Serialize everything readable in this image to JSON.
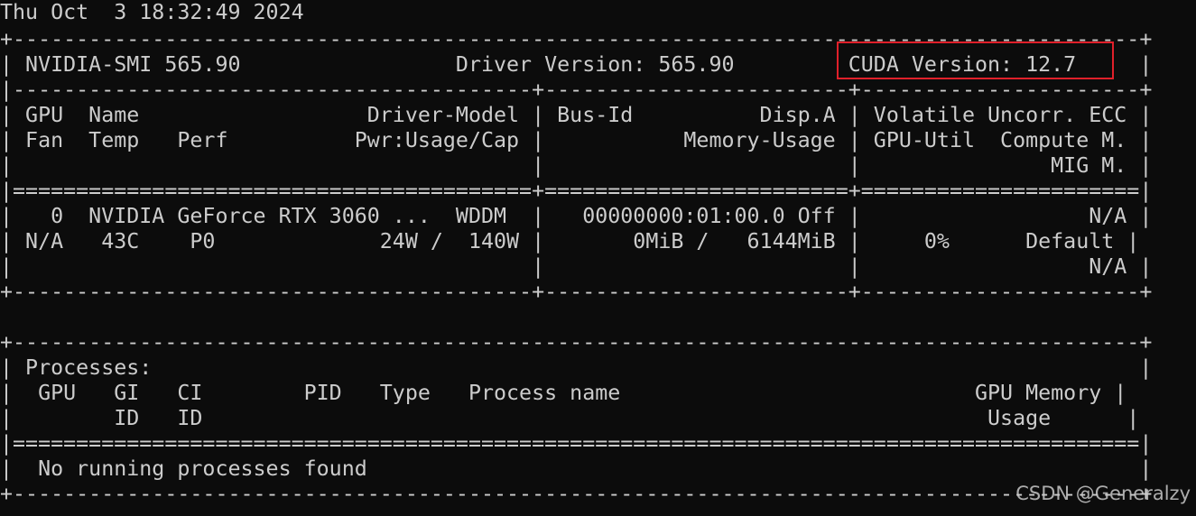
{
  "terminal": {
    "lines": [
      "Thu Oct  3 18:32:49 2024",
      "+-----------------------------------------------------------------------------------------+",
      "| NVIDIA-SMI 565.90                 Driver Version: 565.90         CUDA Version: 12.7     |",
      "|-----------------------------------------+------------------------+----------------------+",
      "| GPU  Name                  Driver-Model | Bus-Id          Disp.A | Volatile Uncorr. ECC |",
      "| Fan  Temp   Perf          Pwr:Usage/Cap |           Memory-Usage | GPU-Util  Compute M. |",
      "|                                         |                        |               MIG M. |",
      "|=========================================+========================+======================|",
      "|   0  NVIDIA GeForce RTX 3060 ...  WDDM  |   00000000:01:00.0 Off |                  N/A |",
      "| N/A   43C    P0             24W /  140W |       0MiB /   6144MiB |     0%      Default |",
      "|                                         |                        |                  N/A |",
      "+-----------------------------------------+------------------------+----------------------+",
      "",
      "+-----------------------------------------------------------------------------------------+",
      "| Processes:                                                                              |",
      "|  GPU   GI   CI        PID   Type   Process name                            GPU Memory |",
      "|        ID   ID                                                              Usage      |",
      "|=========================================================================================|",
      "|  No running processes found                                                             |",
      "+-----------------------------------------------------------------------------------------+"
    ]
  },
  "watermark": "CSDN @Generalzy",
  "colors": {
    "background": "#0c0c0c",
    "text": "#cccccc",
    "highlight": "#e0202a"
  }
}
